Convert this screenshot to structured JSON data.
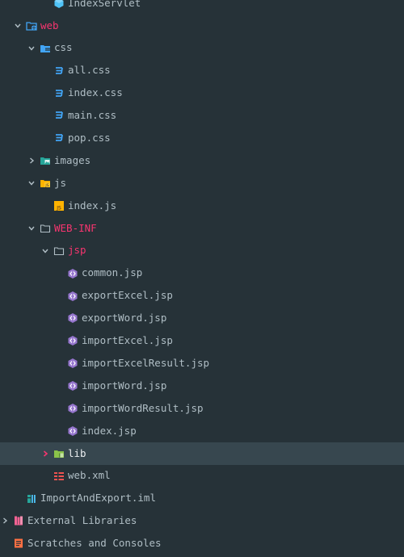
{
  "tree": {
    "items": [
      {
        "label": "IndexServlet",
        "icon": "java-class-icon"
      },
      {
        "label": "web",
        "icon": "web-folder-icon"
      },
      {
        "label": "css",
        "icon": "folder-icon"
      },
      {
        "label": "all.css",
        "icon": "css-file-icon"
      },
      {
        "label": "index.css",
        "icon": "css-file-icon"
      },
      {
        "label": "main.css",
        "icon": "css-file-icon"
      },
      {
        "label": "pop.css",
        "icon": "css-file-icon"
      },
      {
        "label": "images",
        "icon": "images-folder-icon"
      },
      {
        "label": "js",
        "icon": "js-folder-icon"
      },
      {
        "label": "index.js",
        "icon": "js-file-icon"
      },
      {
        "label": "WEB-INF",
        "icon": "folder-outline-icon"
      },
      {
        "label": "jsp",
        "icon": "folder-outline-icon"
      },
      {
        "label": "common.jsp",
        "icon": "jsp-file-icon"
      },
      {
        "label": "exportExcel.jsp",
        "icon": "jsp-file-icon"
      },
      {
        "label": "exportWord.jsp",
        "icon": "jsp-file-icon"
      },
      {
        "label": "importExcel.jsp",
        "icon": "jsp-file-icon"
      },
      {
        "label": "importExcelResult.jsp",
        "icon": "jsp-file-icon"
      },
      {
        "label": "importWord.jsp",
        "icon": "jsp-file-icon"
      },
      {
        "label": "importWordResult.jsp",
        "icon": "jsp-file-icon"
      },
      {
        "label": "index.jsp",
        "icon": "jsp-file-icon"
      },
      {
        "label": "lib",
        "icon": "lib-folder-icon"
      },
      {
        "label": "web.xml",
        "icon": "xml-file-icon"
      },
      {
        "label": "ImportAndExport.iml",
        "icon": "iml-file-icon"
      },
      {
        "label": "External Libraries",
        "icon": "external-libraries-icon"
      },
      {
        "label": "Scratches and Consoles",
        "icon": "scratches-icon"
      }
    ]
  },
  "colors": {
    "background": "#263238",
    "selection": "#37474f",
    "text": "#b0bec5",
    "accent_red": "#f7356f",
    "selected_text": "#eceff1"
  }
}
